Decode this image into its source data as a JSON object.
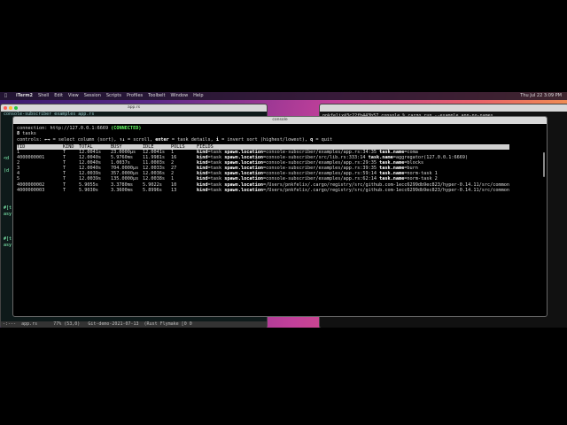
{
  "menubar": {
    "apple": "",
    "items": [
      "iTerm2",
      "Shell",
      "Edit",
      "View",
      "Session",
      "Scripts",
      "Profiles",
      "Toolbelt",
      "Window",
      "Help"
    ],
    "clock": "Thu Jul 22  3:09 PM"
  },
  "editor": {
    "title": "app.rs",
    "tabs": "console-subscriber  examples  app.rs",
    "lines": [
      " ",
      "",
      " ",
      " ",
      " ",
      "",
      "<d",
      " ",
      "(d",
      "",
      "",
      "",
      "",
      "",
      "#[t",
      "asy",
      "",
      "",
      "",
      "#[t",
      "asy"
    ],
    "status": "-:---  app.rs      77% (53,0)   Git-demo-2021-07-13  (Rust Flymake [0 0"
  },
  "right_terminal": {
    "prompt": "pnkfelix@3c22fb443b57 console % cargo run --example app-no-names"
  },
  "console": {
    "title": "console",
    "connection_label": "connection: http://127.0.0.1:6669 ",
    "connection_status": "(CONNECTED)",
    "task_count": "8",
    "task_word": " tasks",
    "controls": [
      {
        "t": "controls: "
      },
      {
        "t": "←→",
        "b": true
      },
      {
        "t": " = select column (sort), "
      },
      {
        "t": "↑↓",
        "b": true
      },
      {
        "t": " = scroll, "
      },
      {
        "t": "enter",
        "b": true
      },
      {
        "t": " = task details, "
      },
      {
        "t": "i",
        "b": true
      },
      {
        "t": " = invert sort (highest/lowest), "
      },
      {
        "t": "q",
        "b": true
      },
      {
        "t": " = quit"
      }
    ],
    "columns": [
      "TID",
      "KIND",
      "TOTAL",
      "BUSY",
      "IDLE",
      "POLLS",
      "FIELDS"
    ],
    "rows": [
      {
        "tid": "1",
        "kind": "T",
        "total": "12.0041s",
        "busy": "23.0000µs",
        "idle": "12.0041s",
        "polls": "1",
        "f1": "kind",
        "v1": "=task ",
        "f2": "spawn.location",
        "v2": "=console-subscriber/examples/app.rs:34:35 ",
        "f3": "task.name",
        "v3": "=coma"
      },
      {
        "tid": "4000000001",
        "kind": "T",
        "total": "12.0040s",
        "busy": "5.9760ms",
        "idle": "11.9981s",
        "polls": "16",
        "f1": "kind",
        "v1": "=task ",
        "f2": "spawn.location",
        "v2": "=console-subscriber/src/lib.rs:333:14 ",
        "f3": "task.name",
        "v3": "=aggregator(127.0.0.1:6669)"
      },
      {
        "tid": "2",
        "kind": "T",
        "total": "12.0040s",
        "busy": "1.0037s",
        "idle": "11.0003s",
        "polls": "2",
        "f1": "kind",
        "v1": "=task ",
        "f2": "spawn.location",
        "v2": "=console-subscriber/examples/app.rs:29:35 ",
        "f3": "task.name",
        "v3": "=blocks"
      },
      {
        "tid": "3",
        "kind": "T",
        "total": "12.0040s",
        "busy": "704.0000µs",
        "idle": "12.0033s",
        "polls": "27",
        "f1": "kind",
        "v1": "=task ",
        "f2": "spawn.location",
        "v2": "=console-subscriber/examples/app.rs:39:35 ",
        "f3": "task.name",
        "v3": "=burn"
      },
      {
        "tid": "4",
        "kind": "T",
        "total": "12.0039s",
        "busy": "357.0000µs",
        "idle": "12.0036s",
        "polls": "2",
        "f1": "kind",
        "v1": "=task ",
        "f2": "spawn.location",
        "v2": "=console-subscriber/examples/app.rs:59:14 ",
        "f3": "task.name",
        "v3": "=norm-task 1"
      },
      {
        "tid": "5",
        "kind": "T",
        "total": "12.0039s",
        "busy": "135.0000µs",
        "idle": "12.0038s",
        "polls": "1",
        "f1": "kind",
        "v1": "=task ",
        "f2": "spawn.location",
        "v2": "=console-subscriber/examples/app.rs:62:14 ",
        "f3": "task.name",
        "v3": "=norm-task 2"
      },
      {
        "tid": "4000000002",
        "kind": "T",
        "total": "5.9055s",
        "busy": "3.3780ms",
        "idle": "5.9022s",
        "polls": "10",
        "f1": "kind",
        "v1": "=task ",
        "f2": "spawn.location",
        "v2": "=/Users/pnkfelix/.cargo/registry/src/github.com-1ecc6299db9ec823/hyper-0.14.11/src/common",
        "f3": "",
        "v3": ""
      },
      {
        "tid": "4000000003",
        "kind": "T",
        "total": "5.9030s",
        "busy": "3.3600ms",
        "idle": "5.8996s",
        "polls": "13",
        "f1": "kind",
        "v1": "=task ",
        "f2": "spawn.location",
        "v2": "=/Users/pnkfelix/.cargo/registry/src/github.com-1ecc6299db9ec823/hyper-0.14.11/src/common",
        "f3": "",
        "v3": ""
      }
    ]
  }
}
